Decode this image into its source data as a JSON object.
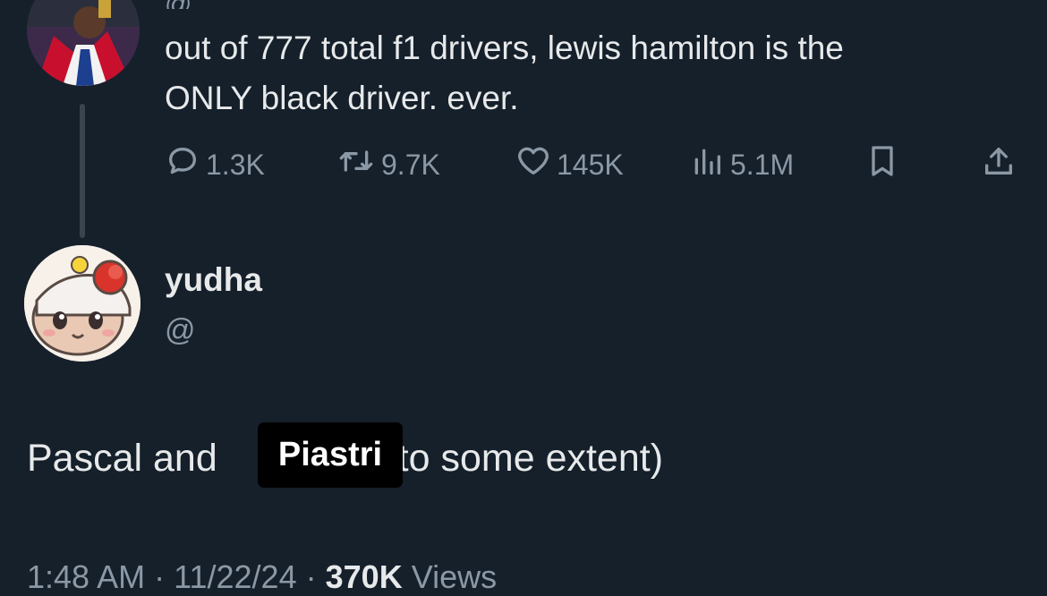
{
  "parent_tweet": {
    "header_partial": "@",
    "text_line1": "out of 777 total f1 drivers, lewis hamilton is the",
    "text_line2": "ONLY black driver. ever.",
    "actions": {
      "replies": "1.3K",
      "reposts": "9.7K",
      "likes": "145K",
      "views": "5.1M"
    }
  },
  "reply": {
    "name": "yudha",
    "handle": "@",
    "text_before": "Pascal and",
    "text_after": "to some extent)",
    "overlay_label": "Piastri"
  },
  "meta": {
    "time": "1:48 AM",
    "date": "11/22/24",
    "views_count": "370K",
    "views_label": "Views",
    "separator": "·"
  },
  "colors": {
    "background": "#15202b",
    "text_primary": "#e7e9ea",
    "text_secondary": "#8b98a5"
  }
}
